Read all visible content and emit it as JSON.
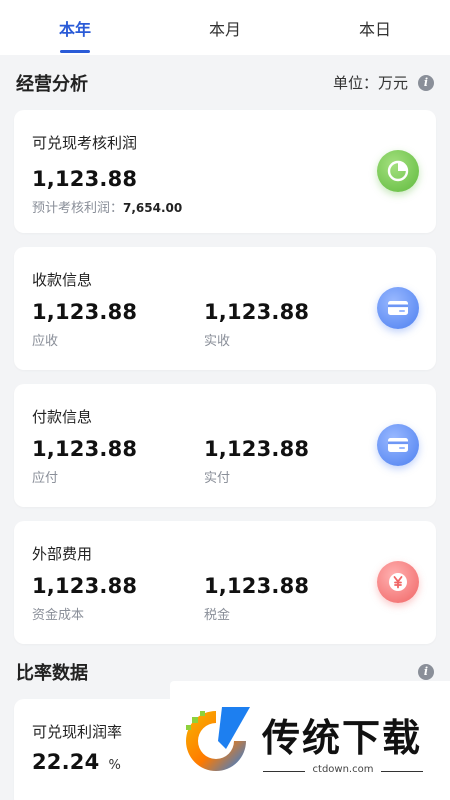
{
  "tabs": [
    {
      "label": "本年",
      "active": true
    },
    {
      "label": "本月",
      "active": false
    },
    {
      "label": "本日",
      "active": false
    }
  ],
  "analysis": {
    "title": "经营分析",
    "unit_label": "单位：万元",
    "info_icon": "info-icon"
  },
  "cards": {
    "profit": {
      "title": "可兑现考核利润",
      "value": "1,123.88",
      "sub_label": "预计考核利润：",
      "sub_value": "7,654.00",
      "icon": "pie-chart-icon"
    },
    "receipt": {
      "title": "收款信息",
      "left_value": "1,123.88",
      "left_label": "应收",
      "right_value": "1,123.88",
      "right_label": "实收",
      "icon": "card-icon"
    },
    "payment": {
      "title": "付款信息",
      "left_value": "1,123.88",
      "left_label": "应付",
      "right_value": "1,123.88",
      "right_label": "实付",
      "icon": "card-icon"
    },
    "expense": {
      "title": "外部费用",
      "left_value": "1,123.88",
      "left_label": "资金成本",
      "right_value": "1,123.88",
      "right_label": "税金",
      "icon": "yen-icon"
    }
  },
  "ratio": {
    "title": "比率数据",
    "card_title": "可兑现利润率",
    "value": "22.24",
    "unit": "%"
  },
  "watermark": {
    "name": "传统下载",
    "url": "ctdown.com"
  },
  "colors": {
    "accent": "#2a5bd7",
    "green": "#5fba3d",
    "blue": "#4c7ff0",
    "red": "#f06464"
  }
}
